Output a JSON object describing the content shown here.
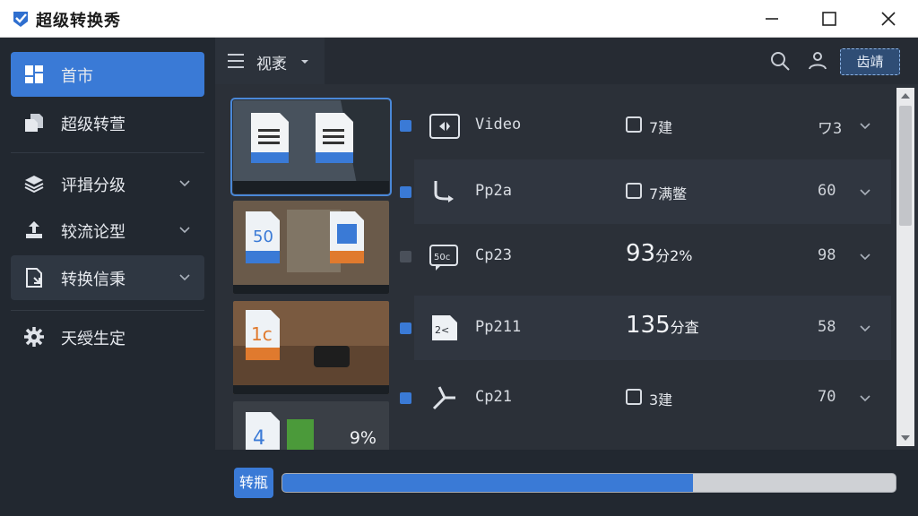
{
  "window": {
    "title": "超级转换秀",
    "minimize_icon": "minimize-icon",
    "maximize_icon": "maximize-icon",
    "close_icon": "close-icon"
  },
  "sidebar": {
    "items": [
      {
        "label": "首市",
        "icon": "home-grid-icon",
        "state": "active"
      },
      {
        "label": "超级转萱",
        "icon": "files-icon",
        "state": "normal"
      },
      {
        "label": "评揖分级",
        "icon": "layers-icon",
        "state": "normal",
        "chevron": true
      },
      {
        "label": "较流论型",
        "icon": "upload-icon",
        "state": "normal",
        "chevron": true
      },
      {
        "label": "转换信秉",
        "icon": "document-icon",
        "state": "highlight",
        "chevron": true
      },
      {
        "label": "天绶生定",
        "icon": "gear-icon",
        "state": "normal"
      }
    ]
  },
  "toolbar": {
    "view_label": "视袤",
    "login_label": "齿靖"
  },
  "thumbnails": [
    {
      "percent": "",
      "selected": true
    },
    {
      "percent": "",
      "selected": false
    },
    {
      "percent": "",
      "selected": false
    },
    {
      "percent": "9%",
      "selected": false
    }
  ],
  "rows": [
    {
      "name": "Video",
      "status": "7建",
      "status_type": "checkbox",
      "num": "ワ3",
      "checked": true
    },
    {
      "name": "Pp2a",
      "status": "7满鳖",
      "status_type": "checkbox",
      "num": "60",
      "checked": true
    },
    {
      "name": "Cp23",
      "status": "93",
      "status_unit": "分2%",
      "status_type": "big",
      "num": "98",
      "checked": false
    },
    {
      "name": "Pp211",
      "status": "135",
      "status_unit": "分査",
      "status_type": "big",
      "num": "58",
      "checked": true
    },
    {
      "name": "Cp21",
      "status": "3建",
      "status_type": "checkbox",
      "num": "70",
      "checked": true
    }
  ],
  "bottom": {
    "convert_label": "转瓶",
    "progress": 0.67
  },
  "colors": {
    "accent": "#3a7ad6",
    "sidebar_bg": "#222830",
    "main_bg": "#2b3038"
  }
}
